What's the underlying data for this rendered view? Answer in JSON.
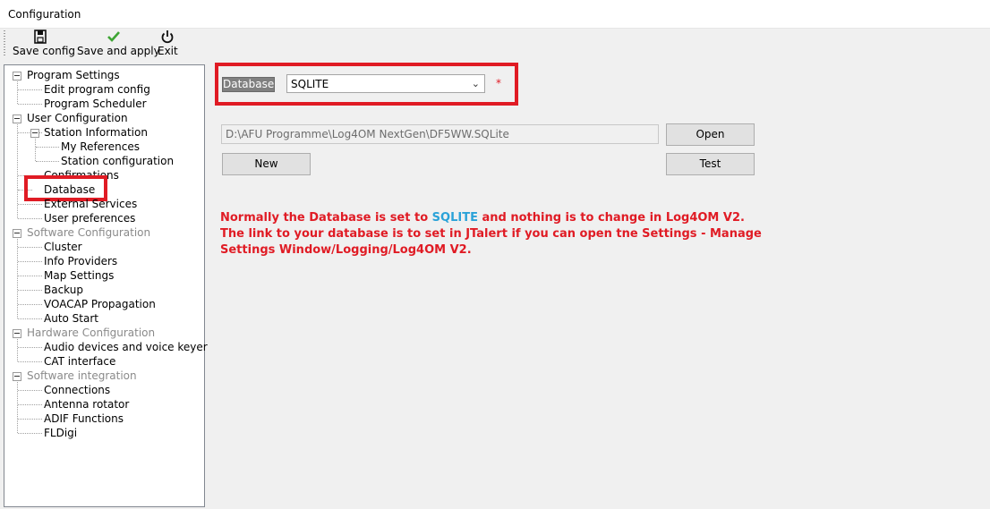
{
  "window": {
    "title": "Configuration"
  },
  "toolbar": {
    "save_config": "Save config",
    "save_and_apply": "Save and apply",
    "exit": "Exit"
  },
  "tree": [
    {
      "label": "Program Settings",
      "level": 0,
      "disabled": false
    },
    {
      "label": "Edit program config",
      "level": 1,
      "disabled": false
    },
    {
      "label": "Program Scheduler",
      "level": 1,
      "disabled": false
    },
    {
      "label": "User Configuration",
      "level": 0,
      "disabled": false
    },
    {
      "label": "Station Information",
      "level": 1,
      "disabled": false
    },
    {
      "label": "My References",
      "level": 2,
      "disabled": false
    },
    {
      "label": "Station configuration",
      "level": 2,
      "disabled": false
    },
    {
      "label": "Confirmations",
      "level": 1,
      "disabled": false
    },
    {
      "label": "Database",
      "level": 1,
      "disabled": false,
      "selected": true
    },
    {
      "label": "External Services",
      "level": 1,
      "disabled": false
    },
    {
      "label": "User preferences",
      "level": 1,
      "disabled": false
    },
    {
      "label": "Software Configuration",
      "level": 0,
      "disabled": true
    },
    {
      "label": "Cluster",
      "level": 1,
      "disabled": false
    },
    {
      "label": "Info Providers",
      "level": 1,
      "disabled": false
    },
    {
      "label": "Map Settings",
      "level": 1,
      "disabled": false
    },
    {
      "label": "Backup",
      "level": 1,
      "disabled": false
    },
    {
      "label": "VOACAP Propagation",
      "level": 1,
      "disabled": false
    },
    {
      "label": "Auto Start",
      "level": 1,
      "disabled": false
    },
    {
      "label": "Hardware Configuration",
      "level": 0,
      "disabled": true
    },
    {
      "label": "Audio devices and voice keyer",
      "level": 1,
      "disabled": false
    },
    {
      "label": "CAT interface",
      "level": 1,
      "disabled": false
    },
    {
      "label": "Software integration",
      "level": 0,
      "disabled": true
    },
    {
      "label": "Connections",
      "level": 1,
      "disabled": false
    },
    {
      "label": "Antenna rotator",
      "level": 1,
      "disabled": false
    },
    {
      "label": "ADIF Functions",
      "level": 1,
      "disabled": false
    },
    {
      "label": "FLDigi",
      "level": 1,
      "disabled": false
    }
  ],
  "database": {
    "label": "Database",
    "type_value": "SQLITE",
    "required_mark": "*",
    "path": "D:\\AFU Programme\\Log4OM NextGen\\DF5WW.SQLite",
    "open_button": "Open",
    "new_button": "New",
    "test_button": "Test"
  },
  "note": {
    "line1_a": "Normally the Database is set to ",
    "line1_hl": "SQLITE",
    "line1_b": " and nothing is to change in Log4OM V2.",
    "line2": "The link to your database is to set in JTalert if you can open tne Settings - Manage",
    "line3": "Settings Window/Logging/Log4OM V2."
  },
  "colors": {
    "annotation_red": "#e01b24",
    "highlight_blue": "#2aa2d8"
  }
}
